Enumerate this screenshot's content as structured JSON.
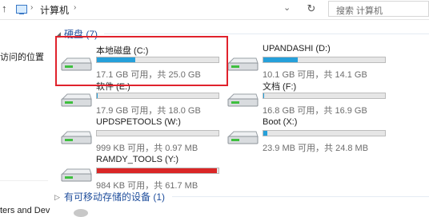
{
  "address": {
    "up_arrow": "↑",
    "sep": "›",
    "crumb": "计算机",
    "dropdown": "⌄",
    "refresh": "↻",
    "search_placeholder": "搜索 计算机"
  },
  "nav": {
    "recent_places": "访问的位置",
    "bottom_item": "ters and Dev"
  },
  "groups": [
    {
      "chevron": "◢",
      "title": "硬盘 (7)"
    },
    {
      "chevron": "▷",
      "title": "有可移动存储的设备 (1)"
    }
  ],
  "drives": [
    {
      "name": "本地磁盘 (C:)",
      "info": "17.1 GB 可用，共 25.0 GB",
      "used_fraction": 0.316,
      "selected": true
    },
    {
      "name": "UPANDASHI (D:)",
      "info": "10.1 GB 可用，共 14.1 GB",
      "used_fraction": 0.284
    },
    {
      "name": "软件 (E:)",
      "info": "17.9 GB 可用，共 18.0 GB",
      "used_fraction": 0.006
    },
    {
      "name": "文档 (F:)",
      "info": "16.8 GB 可用，共 16.9 GB",
      "used_fraction": 0.006
    },
    {
      "name": "UPDSPETOOLS (W:)",
      "info": "999 KB 可用，共 0.97 MB",
      "used_fraction": 0.0
    },
    {
      "name": "Boot (X:)",
      "info": "23.9 MB 可用，共 24.8 MB",
      "used_fraction": 0.036
    },
    {
      "name": "RAMDY_TOOLS (Y:)",
      "info": "984 KB 可用，共 61.7 MB",
      "used_fraction": 0.984,
      "full": true
    }
  ],
  "colors": {
    "bar_normal": "#26a0da",
    "bar_full": "#da2626",
    "highlight": "#e0222c",
    "group_title": "#1f4e9c"
  }
}
